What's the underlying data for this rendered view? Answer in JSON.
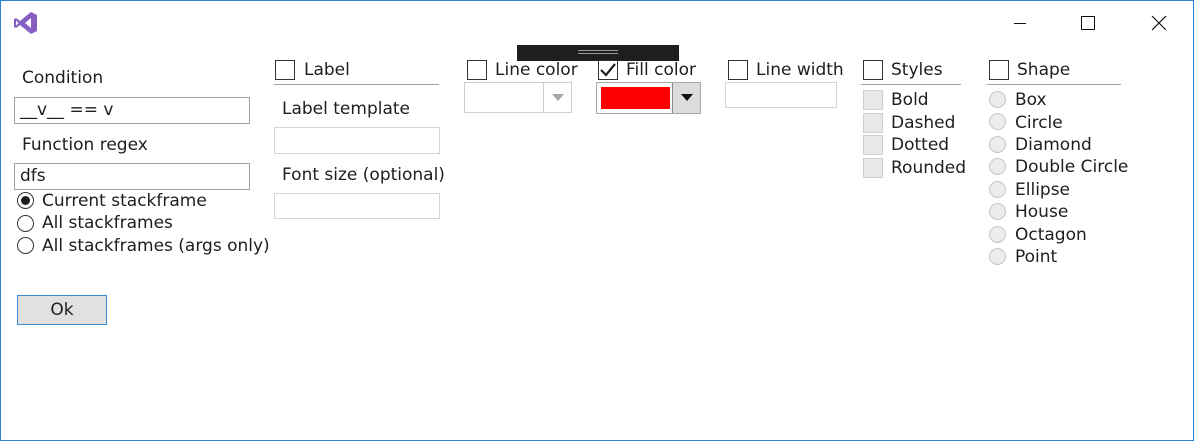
{
  "titlebar": {
    "logo_icon": "visual-studio-icon",
    "minimize_icon": "minimize-icon",
    "maximize_icon": "maximize-icon",
    "close_icon": "close-icon",
    "accent_color": "#2b7fd4"
  },
  "condition": {
    "label": "Condition",
    "value": "__v__ == v"
  },
  "function_regex": {
    "label": "Function regex",
    "value": "dfs"
  },
  "scope": {
    "options": [
      "Current stackframe",
      "All stackframes",
      "All stackframes (args only)"
    ],
    "selected": "Current stackframe"
  },
  "ok_label": "Ok",
  "label_section": {
    "checkbox_label": "Label",
    "checked": false,
    "template_label": "Label template",
    "template_value": "",
    "font_size_label": "Font size (optional)",
    "font_size_value": ""
  },
  "line_color": {
    "checkbox_label": "Line color",
    "checked": false,
    "value": ""
  },
  "fill_color": {
    "checkbox_label": "Fill color",
    "checked": true,
    "color": "#ff0000"
  },
  "line_width": {
    "checkbox_label": "Line width",
    "checked": false,
    "value": ""
  },
  "styles": {
    "checkbox_label": "Styles",
    "checked": false,
    "options": [
      "Bold",
      "Dashed",
      "Dotted",
      "Rounded"
    ]
  },
  "shape": {
    "checkbox_label": "Shape",
    "checked": false,
    "options": [
      "Box",
      "Circle",
      "Diamond",
      "Double Circle",
      "Ellipse",
      "House",
      "Octagon",
      "Point"
    ]
  }
}
